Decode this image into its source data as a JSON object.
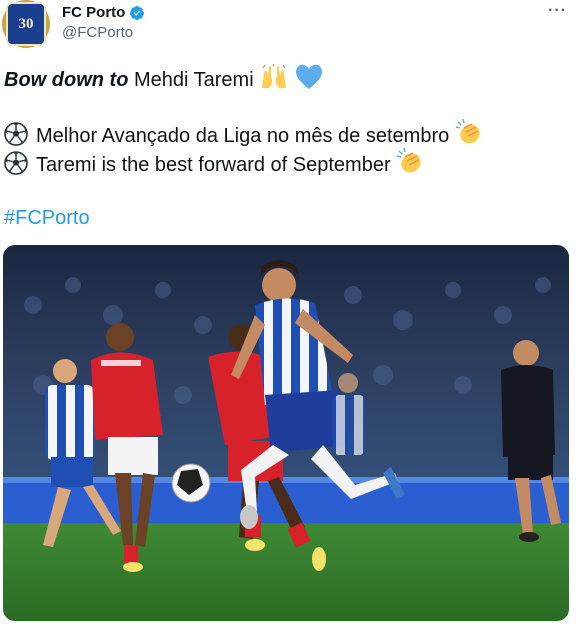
{
  "author": {
    "display_name": "FC Porto",
    "handle": "@FCPorto",
    "verified": true,
    "avatar_text": "30",
    "avatar_icon": "club-crest-avatar"
  },
  "menu_icon": "more-horizontal-icon",
  "tweet": {
    "line1_bold": "Bow down to",
    "line1_rest": " Mehdi Taremi",
    "line1_emojis": [
      "raising-hands-emoji",
      "blue-heart-emoji"
    ],
    "line2": "Melhor Avançado da Liga no mês de setembro",
    "line3": "Taremi is the best forward of September",
    "line_icons": [
      "soccer-ball-emoji",
      "clapping-hands-emoji"
    ],
    "hashtag": "#FCPorto"
  },
  "media": {
    "description_icon": "match-photo",
    "colors": {
      "grass": "#2f7a2a",
      "porto_blue": "#1f4fb3",
      "braga_red": "#d8222b"
    }
  },
  "colors": {
    "link": "#1d9bf0",
    "secondary": "#536471",
    "verified": "#1d9bf0"
  }
}
